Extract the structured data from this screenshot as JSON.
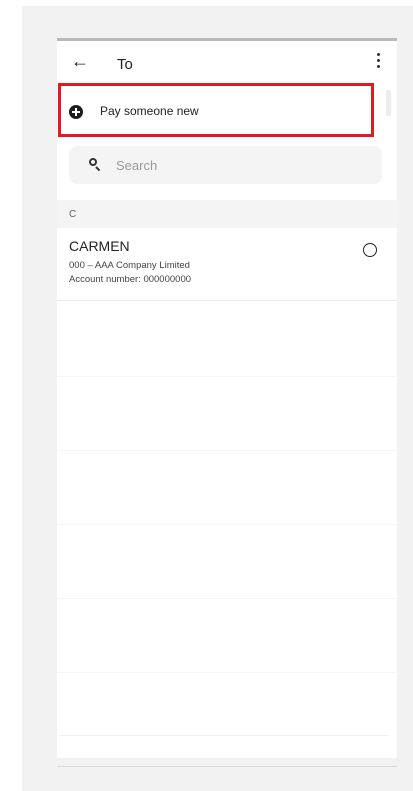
{
  "header": {
    "back_icon": "arrow-left-icon",
    "back_glyph": "←",
    "title": "To",
    "menu_icon": "more-vertical-icon"
  },
  "pay_new": {
    "icon": "plus-circle-icon",
    "label": "Pay someone new"
  },
  "search": {
    "icon": "search-icon",
    "placeholder": "Search"
  },
  "sections": [
    {
      "label": "C",
      "payees": [
        {
          "name": "CARMEN",
          "bank": "000 – AAA Company Limited",
          "account": "Account number: 000000000",
          "selected": false
        }
      ]
    }
  ],
  "colors": {
    "highlight": "#e21b23",
    "background": "#f2f2f2"
  }
}
